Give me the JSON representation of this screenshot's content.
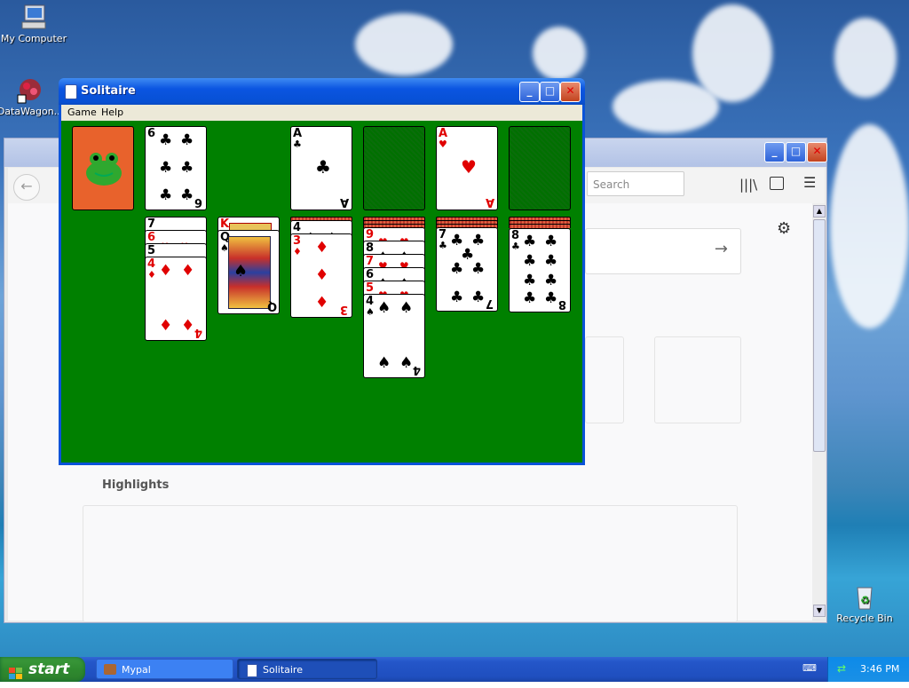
{
  "desktop": {
    "icons": [
      {
        "label": "My Computer"
      },
      {
        "label": "DataWagon..."
      },
      {
        "label": "Recycle Bin"
      }
    ]
  },
  "browser": {
    "search_placeholder": "Search",
    "highlights_label": "Highlights",
    "arrow": "→",
    "gear": "⚙"
  },
  "solitaire": {
    "title": "Solitaire",
    "menu": [
      "Game",
      "Help"
    ],
    "foundations": [
      {
        "rank": "A",
        "suit": "♣",
        "color": "black"
      },
      {
        "rank": "",
        "suit": "",
        "color": "empty"
      },
      {
        "rank": "A",
        "suit": "♥",
        "color": "red"
      },
      {
        "rank": "",
        "suit": "",
        "color": "empty"
      }
    ],
    "waste": {
      "rank": "6",
      "suit": "♣"
    },
    "tableau": [
      {
        "visible": [
          "7♠",
          "6♥",
          "5♠",
          "4♦"
        ]
      },
      {
        "visible": [
          "K♥",
          "Q♠"
        ]
      },
      {
        "visible": [
          "4♠",
          "3♦"
        ]
      },
      {
        "visible": [
          "9♥",
          "8♠",
          "7♥",
          "6♠",
          "5♥",
          "4♠"
        ]
      },
      {
        "visible": [
          "7♣"
        ]
      },
      {
        "visible": [
          "8♣"
        ]
      }
    ]
  },
  "taskbar": {
    "start_label": "start",
    "tasks": [
      "Mypal",
      "Solitaire"
    ],
    "clock": "3:46 PM"
  },
  "colors": {
    "felt": "#008000",
    "xp_blue": "#0a53d8",
    "start_green": "#2f8a2f",
    "card_back": "#e8622c"
  }
}
